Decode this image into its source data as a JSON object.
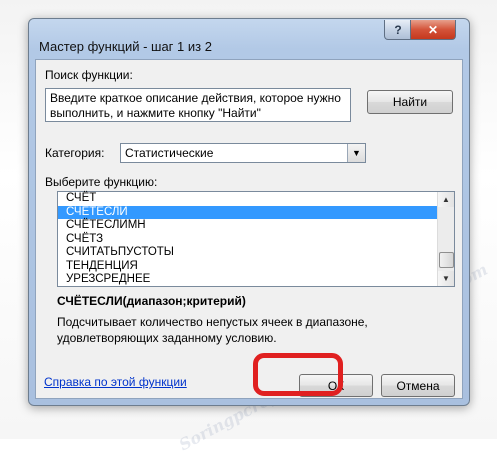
{
  "window": {
    "title": "Мастер функций - шаг 1 из 2",
    "help_label": "?",
    "close_label": "✕"
  },
  "search": {
    "label": "Поиск функции:",
    "description_text": "Введите краткое описание действия, которое нужно выполнить, и нажмите кнопку \"Найти\"",
    "find_button": "Найти"
  },
  "category": {
    "label": "Категория:",
    "selected": "Статистические"
  },
  "function_list": {
    "label": "Выберите функцию:",
    "items": [
      "СЧЁТ",
      "СЧЁТЕСЛИ",
      "СЧЁТЕСЛИМН",
      "СЧЁТЗ",
      "СЧИТАТЬПУСТОТЫ",
      "ТЕНДЕНЦИЯ",
      "УРЕЗСРЕДНЕЕ"
    ],
    "selected_index": 1
  },
  "details": {
    "signature": "СЧЁТЕСЛИ(диапазон;критерий)",
    "description": "Подсчитывает количество непустых ячеек в диапазоне, удовлетворяющих заданному условию."
  },
  "footer": {
    "help_link": "Справка по этой функции",
    "ok_button": "ОК",
    "cancel_button": "Отмена"
  },
  "watermark": "Soringpcrepair.com",
  "colors": {
    "selection": "#3399ff",
    "highlight": "#e02020",
    "link": "#0033cc"
  }
}
